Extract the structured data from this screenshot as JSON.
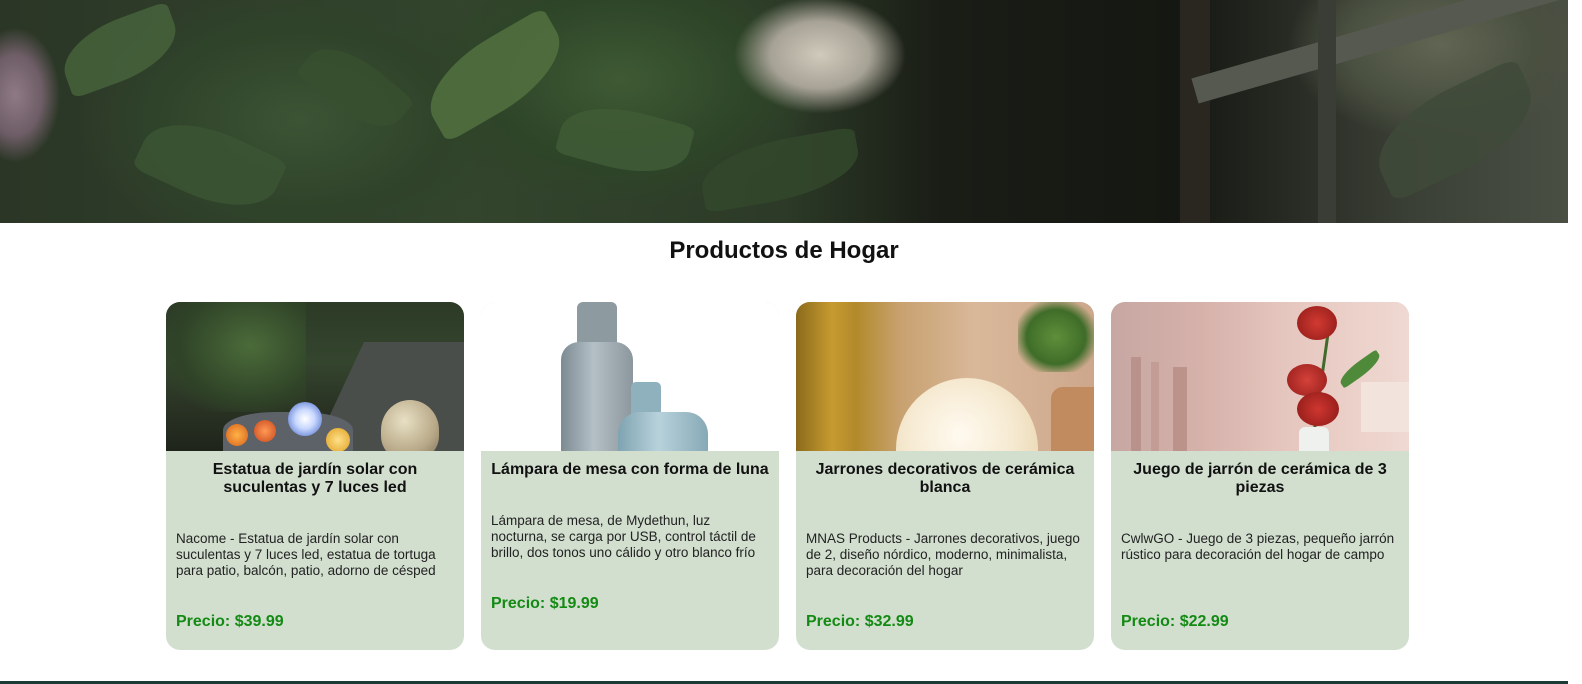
{
  "section": {
    "title": "Productos de Hogar"
  },
  "products": [
    {
      "title": "Estatua de jardín solar con suculentas y 7 luces led",
      "description": "Nacome - Estatua de jardín solar con suculentas y 7 luces led, estatua de tortuga para patio, balcón, patio, adorno de césped",
      "price": "Precio: $39.99"
    },
    {
      "title": "Lámpara de mesa con forma de luna",
      "description": "Lámpara de mesa, de Mydethun, luz nocturna, se carga por USB, control táctil de brillo, dos tonos uno cálido y otro blanco frío",
      "price": "Precio: $19.99"
    },
    {
      "title": "Jarrones decorativos de cerámica blanca",
      "description": "MNAS Products - Jarrones decorativos, juego de 2, diseño nórdico, moderno, minimalista, para decoración del hogar",
      "price": "Precio: $32.99"
    },
    {
      "title": "Juego de jarrón de cerámica de 3 piezas",
      "description": "CwlwGO - Juego de 3 piezas, pequeño jarrón rústico para decoración del hogar de campo",
      "price": "Precio: $22.99"
    }
  ],
  "colors": {
    "card_background": "#d2dfcf",
    "price": "#138a13",
    "footer_line": "#1b3a35"
  }
}
